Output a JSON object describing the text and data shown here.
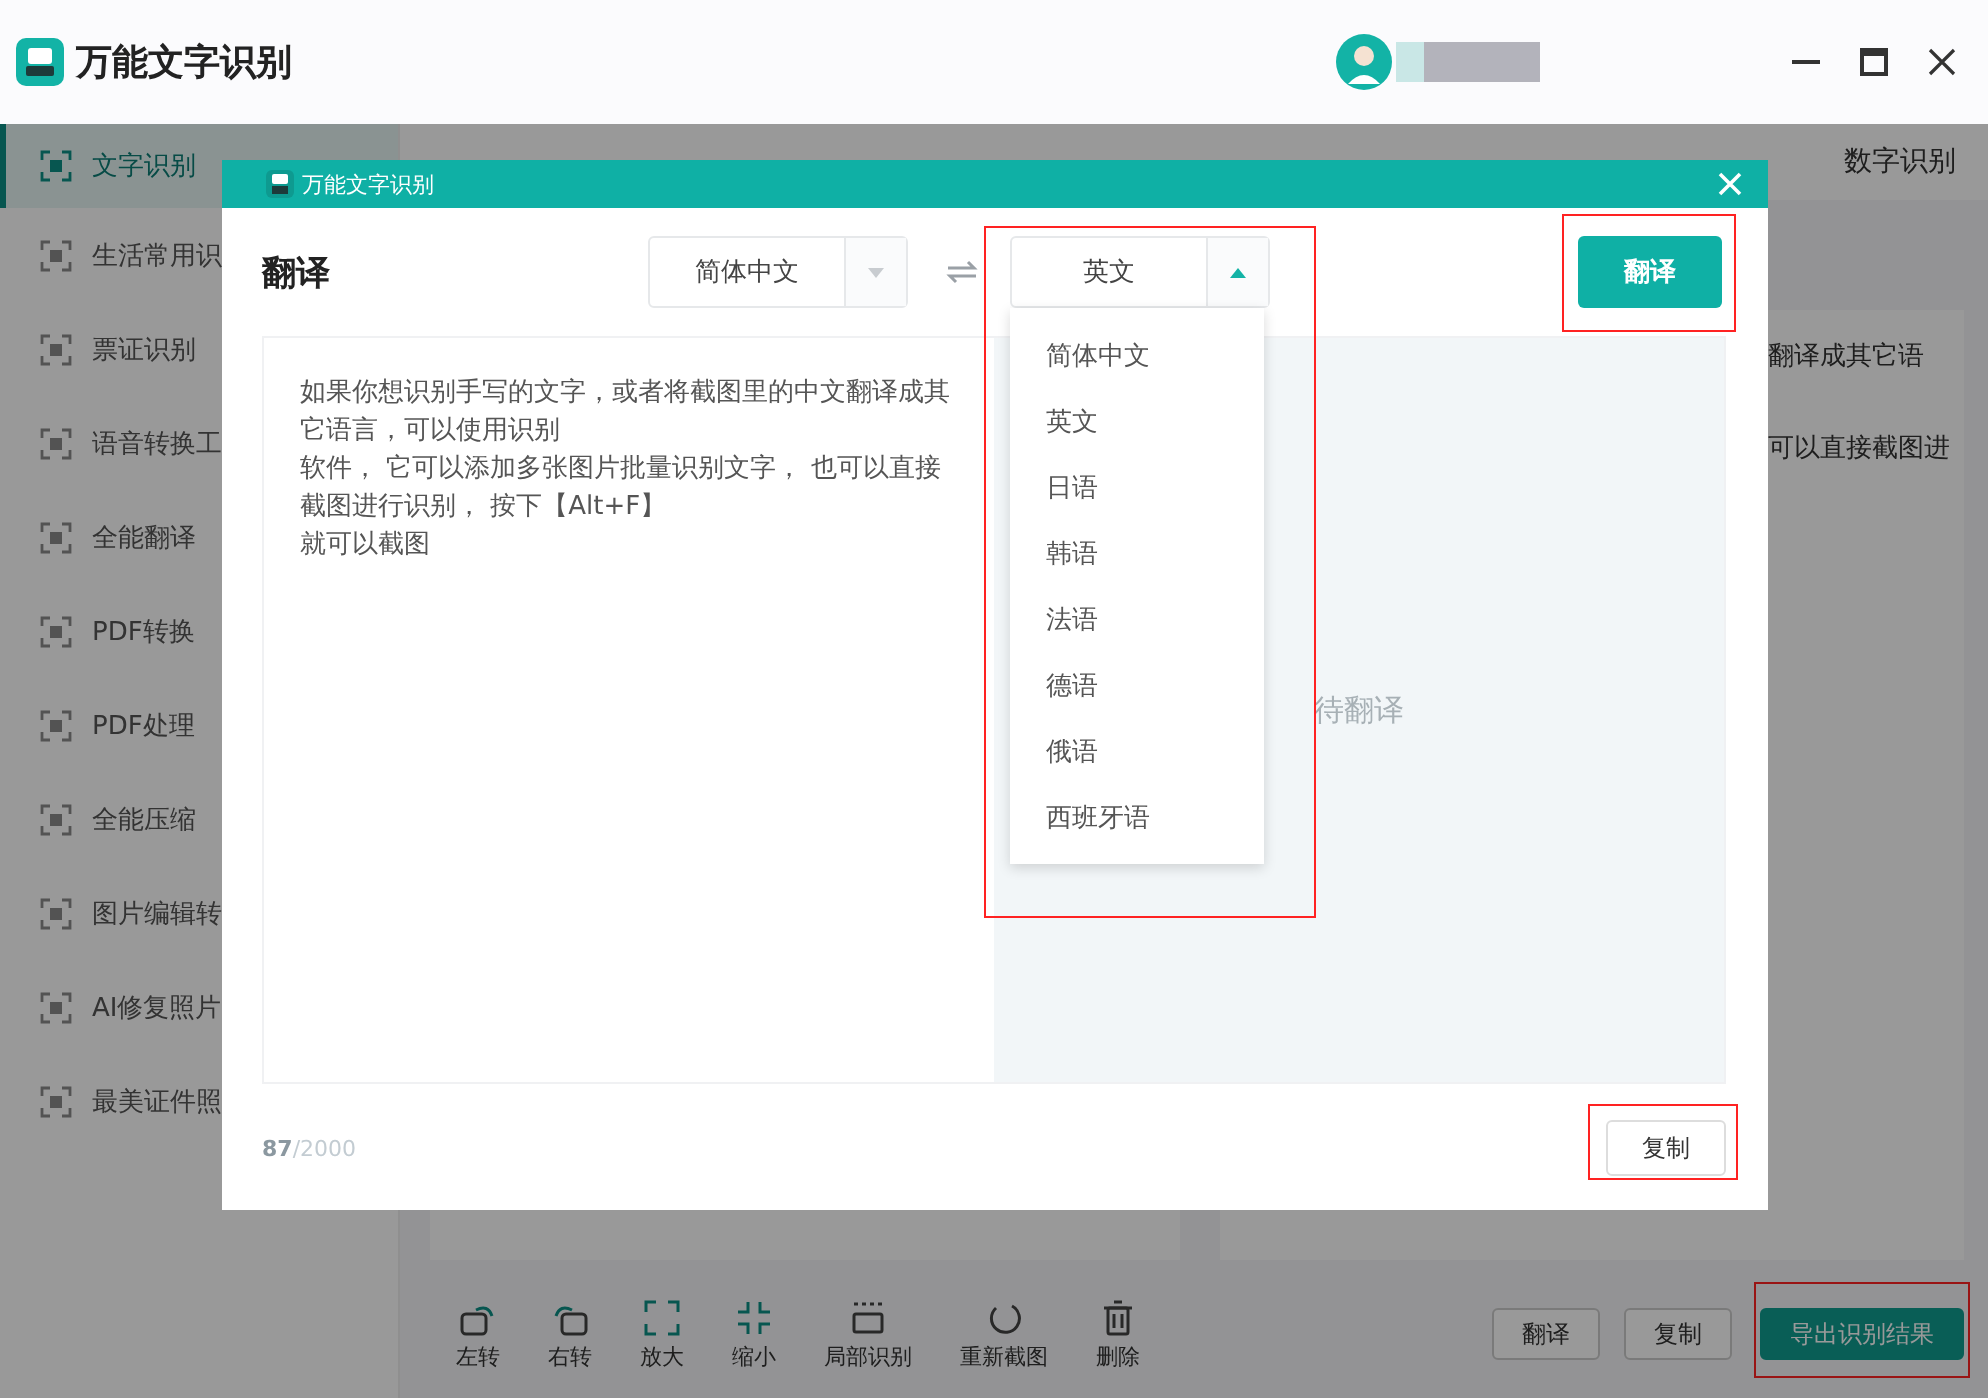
{
  "app": {
    "title": "万能文字识别"
  },
  "sidebar": {
    "items": [
      {
        "label": "文字识别",
        "selected": true
      },
      {
        "label": "生活常用识",
        "selected": false
      },
      {
        "label": "票证识别",
        "selected": false
      },
      {
        "label": "语音转换工",
        "selected": false
      },
      {
        "label": "全能翻译",
        "selected": false
      },
      {
        "label": "PDF转换",
        "selected": false
      },
      {
        "label": "PDF处理",
        "selected": false
      },
      {
        "label": "全能压缩",
        "selected": false
      },
      {
        "label": "图片编辑转",
        "selected": false
      },
      {
        "label": "AI修复照片",
        "selected": false
      },
      {
        "label": "最美证件照",
        "selected": false
      }
    ]
  },
  "tabs": [
    {
      "label": "数字识别",
      "selected": false
    }
  ],
  "result_panel": {
    "lines": [
      "翻译成其它语",
      "可以直接截图进"
    ]
  },
  "toolbar": {
    "tools": [
      {
        "label": "左转",
        "kind": "rotate-left"
      },
      {
        "label": "右转",
        "kind": "rotate-right"
      },
      {
        "label": "放大",
        "kind": "expand"
      },
      {
        "label": "缩小",
        "kind": "shrink"
      },
      {
        "label": "局部识别",
        "kind": "crop"
      },
      {
        "label": "重新截图",
        "kind": "redo"
      },
      {
        "label": "删除",
        "kind": "delete"
      }
    ]
  },
  "actions": [
    {
      "label": "翻译",
      "kind": "outline",
      "highlighted": false
    },
    {
      "label": "复制",
      "kind": "outline",
      "highlighted": false
    },
    {
      "label": "导出识别结果",
      "kind": "primary",
      "highlighted": true
    }
  ],
  "dialog": {
    "title": "万能文字识别",
    "heading": "翻译",
    "source_language": "简体中文",
    "target_language": "英文",
    "dropdown": {
      "expanded": true,
      "highlighted": true,
      "options": [
        {
          "label": "简体中文",
          "selected": false
        },
        {
          "label": "英文",
          "selected": false
        },
        {
          "label": "日语",
          "selected": false
        },
        {
          "label": "韩语",
          "selected": false
        },
        {
          "label": "法语",
          "selected": false
        },
        {
          "label": "德语",
          "selected": false
        },
        {
          "label": "俄语",
          "selected": false
        },
        {
          "label": "西班牙语",
          "selected": false
        }
      ]
    },
    "translate_button": {
      "label": "翻译",
      "highlighted": true
    },
    "source_text": [
      "如果你想识别手写的文字，或者将截图里的中文翻译成其它语言，可以使用识别",
      "软件， 它可以添加多张图片批量识别文字， 也可以直接截图进行识别， 按下【Alt+F】",
      "就可以截图"
    ],
    "placeholder": "待翻译",
    "char_count": "87",
    "char_limit": "/2000",
    "copy_button": {
      "label": "复制",
      "highlighted": true
    }
  }
}
